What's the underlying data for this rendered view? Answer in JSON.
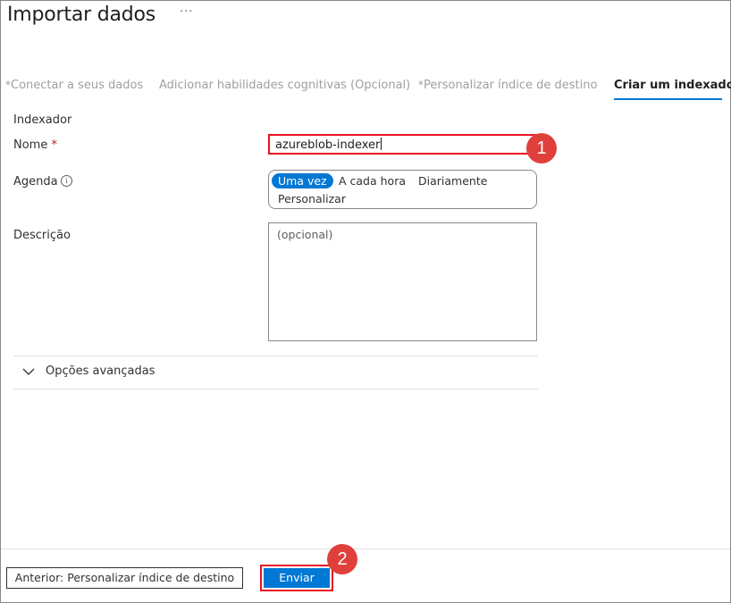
{
  "header": {
    "title": "Importar dados",
    "more_label": "···"
  },
  "steps": [
    {
      "required": "*",
      "label": "Conectar a seus dados"
    },
    {
      "required": "",
      "label": "Adicionar habilidades cognitivas (Opcional)"
    },
    {
      "required": "*",
      "label": "Personalizar índice de destino"
    },
    {
      "required": "",
      "label": "Criar um indexador",
      "active": true
    }
  ],
  "form": {
    "section_label": "Indexador",
    "name": {
      "label": "Nome",
      "required_mark": "*",
      "value": "azureblob-indexer"
    },
    "schedule": {
      "label": "Agenda",
      "info_icon": "info-icon",
      "options": [
        "Uma vez",
        "A cada hora",
        "Diariamente",
        "Personalizar"
      ],
      "selected": "Uma vez"
    },
    "description": {
      "label": "Descrição",
      "placeholder": "(opcional)"
    },
    "advanced": {
      "label": "Opções avançadas",
      "icon": "chevron-down-icon"
    }
  },
  "annotations": {
    "badge_1": "1",
    "badge_2": "2"
  },
  "footer": {
    "previous_label": "Anterior: Personalizar índice de destino",
    "submit_label": "Enviar"
  },
  "colors": {
    "accent": "#0078d4",
    "highlight": "#e81123",
    "badge": "#e0403b",
    "required": "#a4262c"
  }
}
